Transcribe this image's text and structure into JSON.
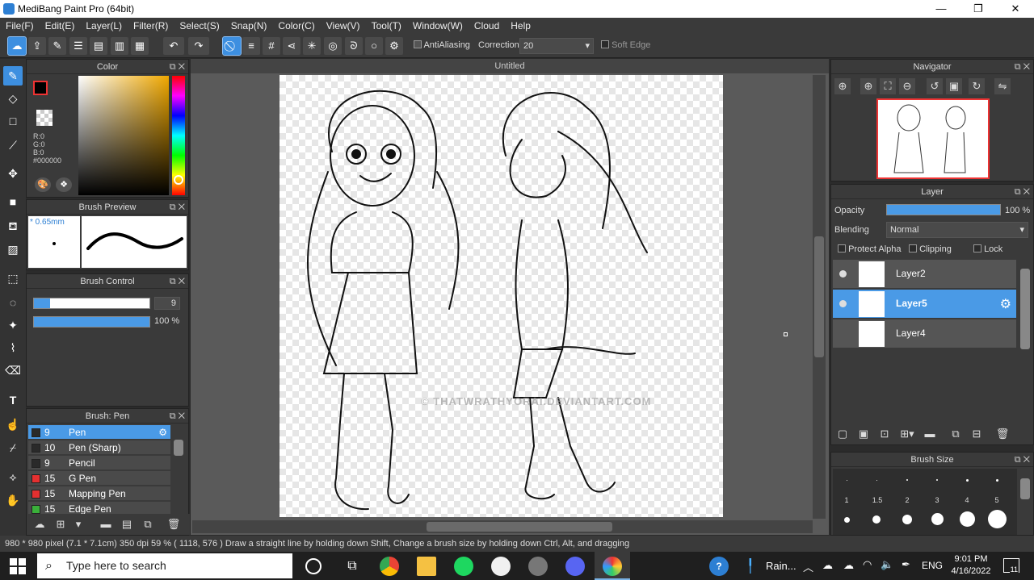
{
  "window": {
    "title": "MediBang Paint Pro (64bit)",
    "minimize": "—",
    "maximize": "❐",
    "close": "✕"
  },
  "menu": [
    "File(F)",
    "Edit(E)",
    "Layer(L)",
    "Filter(R)",
    "Select(S)",
    "Snap(N)",
    "Color(C)",
    "View(V)",
    "Tool(T)",
    "Window(W)",
    "Cloud",
    "Help"
  ],
  "toolbar": {
    "antialiasing_label": "AntiAliasing",
    "correction_label": "Correction",
    "correction_value": "20",
    "soft_edge_label": "Soft Edge"
  },
  "color_panel": {
    "title": "Color",
    "r": "R:0",
    "g": "G:0",
    "b": "B:0",
    "hex": "#000000",
    "fg_color": "#000000",
    "bg_color": "#ffffff"
  },
  "brush_preview": {
    "title": "Brush Preview",
    "size": "* 0.65mm"
  },
  "brush_control": {
    "title": "Brush Control",
    "size_value": "9",
    "opacity_value": "100 %",
    "size_level": 0.14,
    "opacity_level": 1.0
  },
  "brush_list": {
    "title": "Brush: Pen",
    "items": [
      {
        "size": "9",
        "name": "Pen",
        "color": "#2a2a2a",
        "selected": true
      },
      {
        "size": "10",
        "name": "Pen (Sharp)",
        "color": "#2a2a2a"
      },
      {
        "size": "9",
        "name": "Pencil",
        "color": "#2a2a2a"
      },
      {
        "size": "15",
        "name": "G Pen",
        "color": "#e53030"
      },
      {
        "size": "15",
        "name": "Mapping Pen",
        "color": "#e53030"
      },
      {
        "size": "15",
        "name": "Edge Pen",
        "color": "#3ab03a"
      }
    ]
  },
  "document": {
    "tab": "Untitled",
    "watermark": "© THATWRATHYORAI.DEVIANTART.COM"
  },
  "navigator": {
    "title": "Navigator"
  },
  "layer_panel": {
    "title": "Layer",
    "opacity_label": "Opacity",
    "opacity_value": "100 %",
    "opacity_level": 1.0,
    "blending_label": "Blending",
    "blending_value": "Normal",
    "protect_alpha": "Protect Alpha",
    "clipping": "Clipping",
    "lock": "Lock",
    "layers": [
      {
        "name": "Layer2",
        "selected": false,
        "visible": true
      },
      {
        "name": "Layer5",
        "selected": true,
        "visible": true
      },
      {
        "name": "Layer4",
        "selected": false,
        "visible": false
      }
    ]
  },
  "brush_size": {
    "title": "Brush Size",
    "labels": [
      "1",
      "1.5",
      "2",
      "3",
      "4",
      "5"
    ]
  },
  "status": {
    "text": "980 * 980 pixel  (7.1 * 7.1cm)  350 dpi  59 %  ( 1118, 576 )  Draw a straight line by holding down Shift, Change a brush size by holding down Ctrl, Alt, and dragging"
  },
  "taskbar": {
    "search_placeholder": "Type here to search",
    "weather": "Rain...",
    "language": "ENG",
    "time": "9:01 PM",
    "date": "4/16/2022",
    "notifications": "11"
  }
}
